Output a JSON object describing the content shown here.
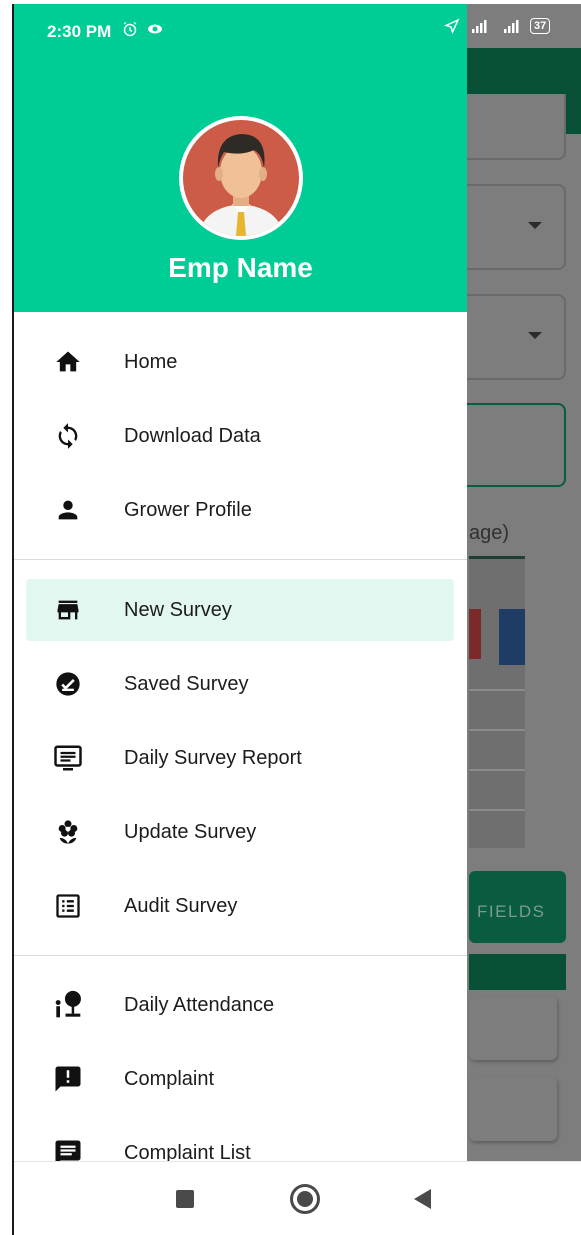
{
  "status_bar": {
    "time": "2:30 PM",
    "battery": "37"
  },
  "drawer": {
    "header": {
      "employee_name": "Emp Name",
      "color": "#00cc96"
    },
    "items": [
      {
        "label": "Home",
        "icon": "home-icon"
      },
      {
        "label": "Download Data",
        "icon": "sync-icon"
      },
      {
        "label": "Grower Profile",
        "icon": "person-icon"
      },
      {
        "label": "New Survey",
        "icon": "store-icon",
        "selected": true
      },
      {
        "label": "Saved Survey",
        "icon": "check-circle-icon"
      },
      {
        "label": "Daily Survey Report",
        "icon": "report-icon"
      },
      {
        "label": "Update Survey",
        "icon": "flower-icon"
      },
      {
        "label": "Audit Survey",
        "icon": "list-alt-icon"
      },
      {
        "label": "Daily Attendance",
        "icon": "attendance-icon"
      },
      {
        "label": "Complaint",
        "icon": "feedback-icon"
      },
      {
        "label": "Complaint List",
        "icon": "message-icon"
      }
    ],
    "selected_background": "#e2f7f0"
  },
  "background_app": {
    "image_hint": "age)",
    "button_label": "FIELDS",
    "toolbar_color": "#074f35"
  },
  "nav_bar": {
    "buttons": [
      "recents-icon",
      "home-button-icon",
      "back-icon"
    ]
  }
}
